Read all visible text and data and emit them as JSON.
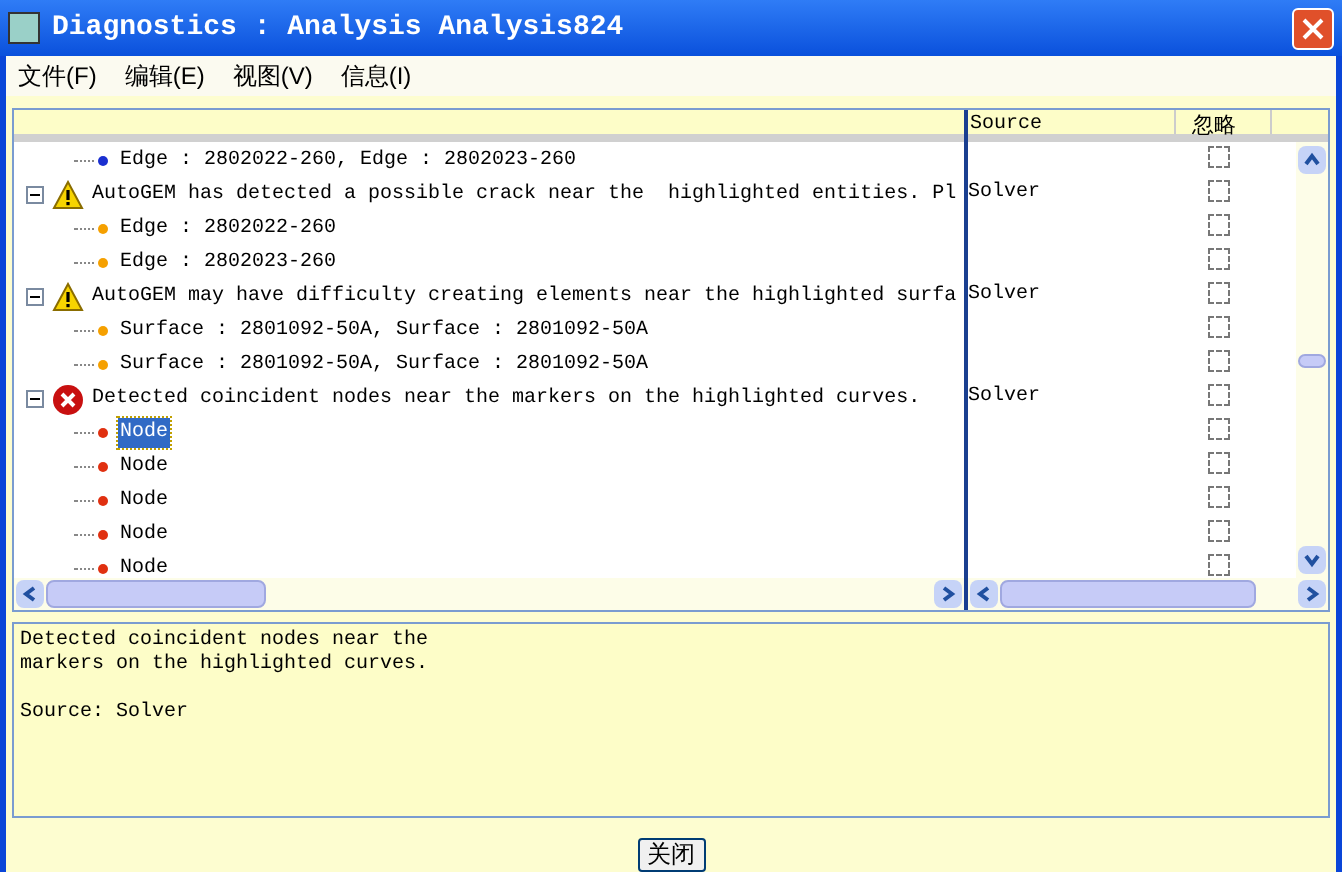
{
  "window": {
    "title": "Diagnostics : Analysis Analysis824"
  },
  "menu": [
    "文件(F)",
    "编辑(E)",
    "视图(V)",
    "信息(I)"
  ],
  "columns": [
    "Source",
    "忽略"
  ],
  "rows": [
    {
      "kind": "entity",
      "text": "Edge : 2802022-260, Edge : 2802023-260",
      "color": "#1a2fd0",
      "selected": false,
      "ignored": false
    },
    {
      "kind": "warning",
      "text": "AutoGEM has detected a possible crack near the  highlighted entities. Pl",
      "source": "Solver",
      "expanded": true,
      "ignored": false,
      "children": [
        {
          "kind": "entity",
          "text": "Edge : 2802022-260",
          "color": "#f5a000",
          "selected": false,
          "ignored": false
        },
        {
          "kind": "entity",
          "text": "Edge : 2802023-260",
          "color": "#f5a000",
          "selected": false,
          "ignored": false
        }
      ]
    },
    {
      "kind": "warning",
      "text": "AutoGEM may have difficulty creating elements near the highlighted surfa",
      "source": "Solver",
      "expanded": true,
      "ignored": false,
      "children": [
        {
          "kind": "entity",
          "text": "Surface : 2801092-50A, Surface : 2801092-50A",
          "color": "#f5a000",
          "selected": false,
          "ignored": false
        },
        {
          "kind": "entity",
          "text": "Surface : 2801092-50A, Surface : 2801092-50A",
          "color": "#f5a000",
          "selected": false,
          "ignored": false
        }
      ]
    },
    {
      "kind": "error",
      "text": "Detected coincident nodes near the markers on the highlighted curves.",
      "source": "Solver",
      "expanded": true,
      "ignored": false,
      "children": [
        {
          "kind": "entity",
          "text": "Node",
          "color": "#e03010",
          "selected": true,
          "ignored": false
        },
        {
          "kind": "entity",
          "text": "Node",
          "color": "#e03010",
          "selected": false,
          "ignored": false
        },
        {
          "kind": "entity",
          "text": "Node",
          "color": "#e03010",
          "selected": false,
          "ignored": false
        },
        {
          "kind": "entity",
          "text": "Node",
          "color": "#e03010",
          "selected": false,
          "ignored": false
        },
        {
          "kind": "entity",
          "text": "Node",
          "color": "#e03010",
          "selected": false,
          "ignored": false
        }
      ]
    }
  ],
  "details": [
    "Detected coincident nodes near the\nmarkers on the highlighted curves.",
    "Source: Solver"
  ],
  "buttons": [
    "关闭"
  ]
}
